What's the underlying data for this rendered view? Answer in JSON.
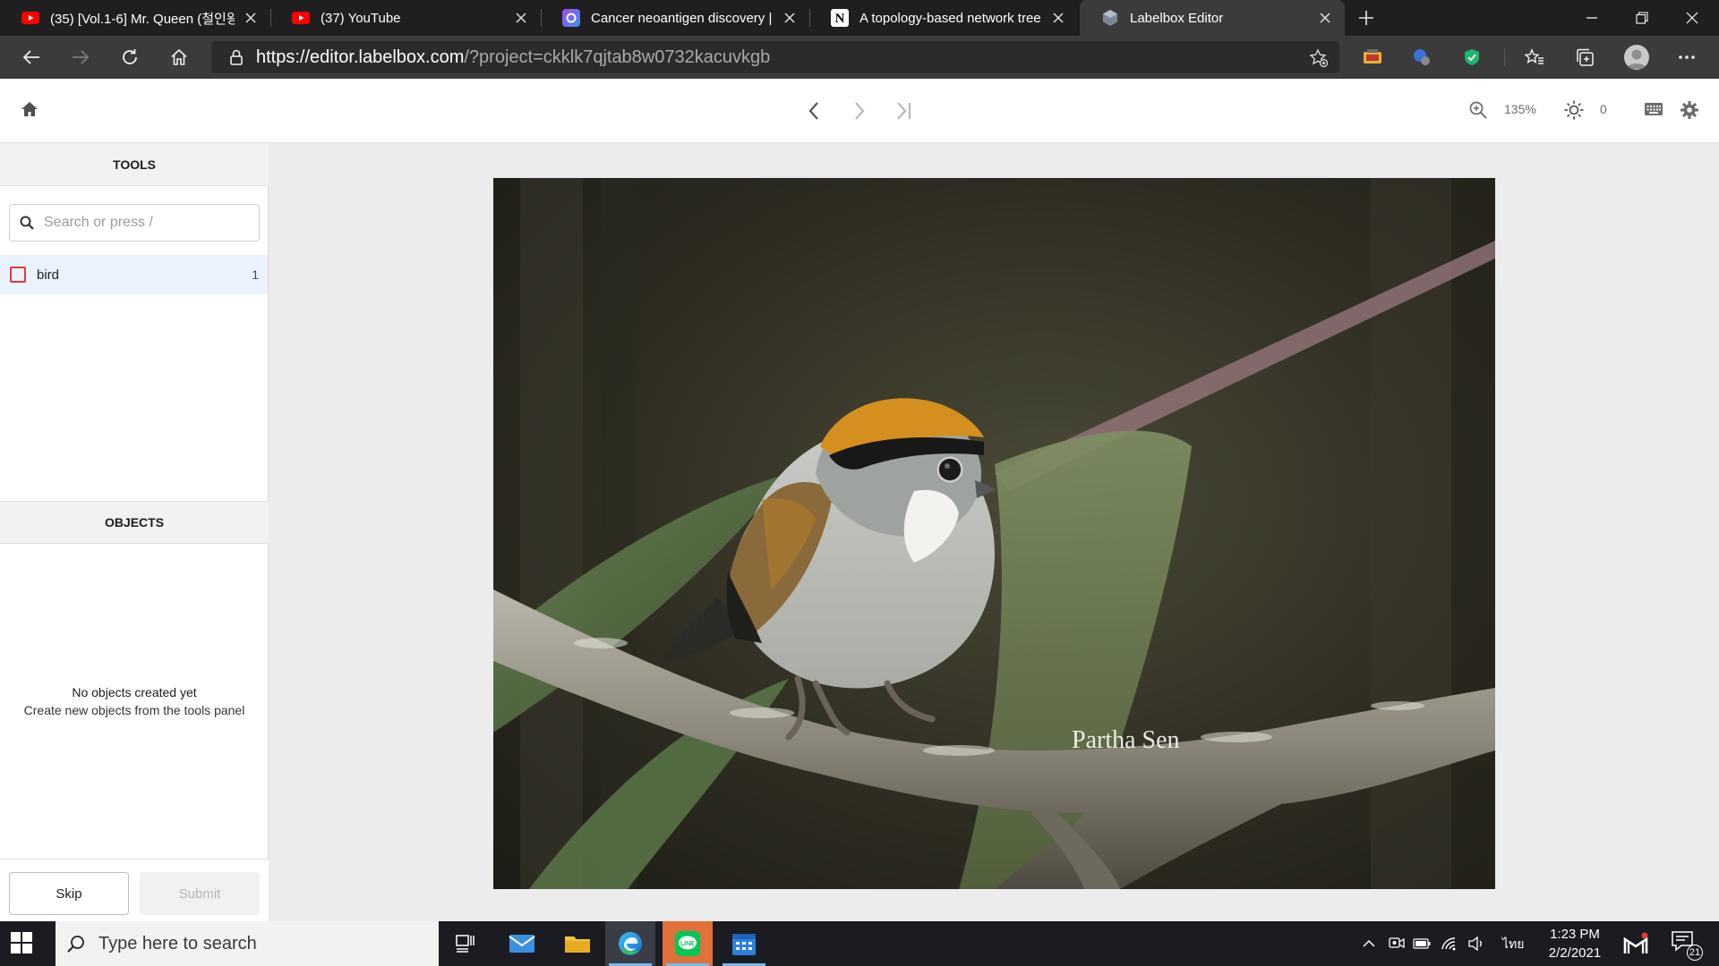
{
  "browser": {
    "tabs": [
      {
        "title": "(35) [Vol.1-6] Mr. Queen (철인왕",
        "icon": "youtube-icon"
      },
      {
        "title": "(37) YouTube",
        "icon": "youtube-icon"
      },
      {
        "title": "Cancer neoantigen discovery | Cl",
        "icon": "app-icon"
      },
      {
        "title": "A topology-based network tree f",
        "icon": "notion-icon"
      },
      {
        "title": "Labelbox Editor",
        "icon": "labelbox-icon"
      }
    ],
    "address": {
      "host": "https://editor.labelbox.com",
      "rest": "/?project=ckklk7qjtab8w0732kacuvkgb"
    }
  },
  "editor": {
    "zoom": "135%",
    "brightness": "0",
    "tools_heading": "TOOLS",
    "search_placeholder": "Search or press /",
    "tools": [
      {
        "name": "bird",
        "count": "1",
        "color": "#e8333b"
      }
    ],
    "objects_heading": "OBJECTS",
    "empty_title": "No objects created yet",
    "empty_subtitle": "Create new objects from the tools panel",
    "skip_label": "Skip",
    "submit_label": "Submit",
    "image_watermark": "Partha Sen"
  },
  "taskbar": {
    "search_placeholder": "Type here to search",
    "language": "ไทย",
    "time": "1:23 PM",
    "date": "2/2/2021",
    "notification_count": "21"
  }
}
